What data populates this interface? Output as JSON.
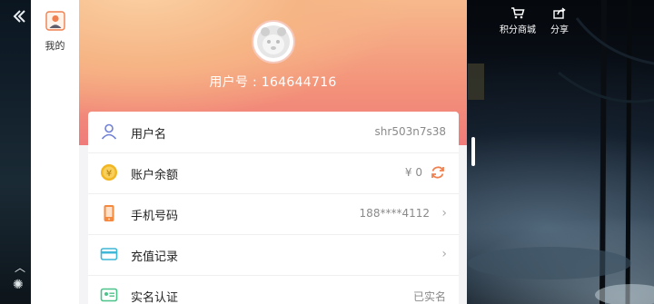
{
  "sidebar": {
    "me_label": "我的"
  },
  "header": {
    "user_id_text": "用户号 : 164644716"
  },
  "rows": [
    {
      "label": "用户名",
      "value": "shr503n7s38",
      "icon": "user-icon"
    },
    {
      "label": "账户余额",
      "value": "¥ 0",
      "icon": "coin-icon"
    },
    {
      "label": "手机号码",
      "value": "188****4112",
      "icon": "phone-icon"
    },
    {
      "label": "充值记录",
      "value": "",
      "icon": "card-icon"
    },
    {
      "label": "实名认证",
      "value": "已实名",
      "icon": "id-card-icon"
    }
  ],
  "top_right": {
    "points_mall": "积分商城",
    "share": "分享"
  },
  "colors": {
    "accent_orange": "#f08050",
    "header_top": "#f7b98c",
    "header_bottom": "#ef7b7a",
    "user_icon": "#6f7fd6",
    "coin": "#f2b623",
    "phone": "#f5893e",
    "card": "#3fb7d6",
    "idcard": "#4cc38a"
  }
}
